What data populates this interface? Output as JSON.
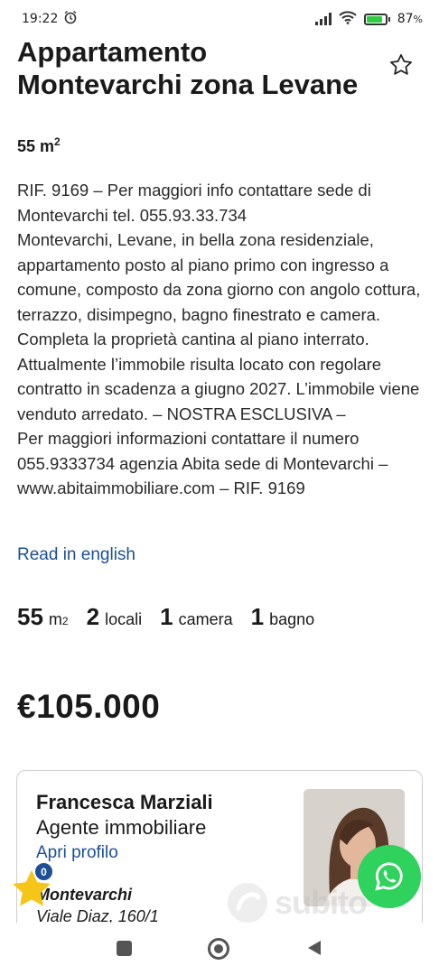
{
  "status_bar": {
    "time": "19:22",
    "battery": "87",
    "battery_unit": "%",
    "battery_level": 0.87,
    "icons": [
      "alarm-icon",
      "signal-icon",
      "wifi-icon",
      "battery-icon"
    ]
  },
  "listing": {
    "title_bold": "Appartamento Montevarchi",
    "title_rest": " zona Levane",
    "area": "55 m",
    "area_sup": "2",
    "description": [
      "RIF. 9169 – Per maggiori info contattare sede di Montevarchi tel. 055.93.33.734",
      "Montevarchi, Levane, in bella zona residenziale, appartamento posto al piano primo con ingresso a comune, composto da zona giorno con angolo cottura, terrazzo, disimpegno, bagno finestrato e camera. Completa la proprietà cantina al piano interrato. Attualmente l’immobile risulta locato con regolare contratto in scadenza a giugno 2027. L’immobile viene venduto arredato. – NOSTRA ESCLUSIVA –",
      "Per maggiori informazioni contattare il numero 055.9333734 agenzia Abita sede di Montevarchi – www.abitaimmobiliare.com – RIF. 9169"
    ],
    "read_english": "Read in english",
    "stats": {
      "area_num": "55",
      "area_unit": "m",
      "area_sup": "2",
      "locali_num": "2",
      "locali_label": "locali",
      "camera_num": "1",
      "camera_label": "camera",
      "bagno_num": "1",
      "bagno_label": "bagno"
    },
    "price": "€105.000"
  },
  "agent": {
    "name": "Francesca Marziali",
    "role": "Agente immobiliare",
    "profile_link": "Apri profilo",
    "city": "Montevarchi",
    "address": "Viale Diaz, 160/1"
  },
  "favorites": {
    "count": "0",
    "star_color": "#f5c518"
  },
  "watermark": {
    "text": "subito"
  },
  "colors": {
    "link": "#1c4f95",
    "whatsapp": "#2fd25d",
    "badge": "#1c4f95"
  }
}
